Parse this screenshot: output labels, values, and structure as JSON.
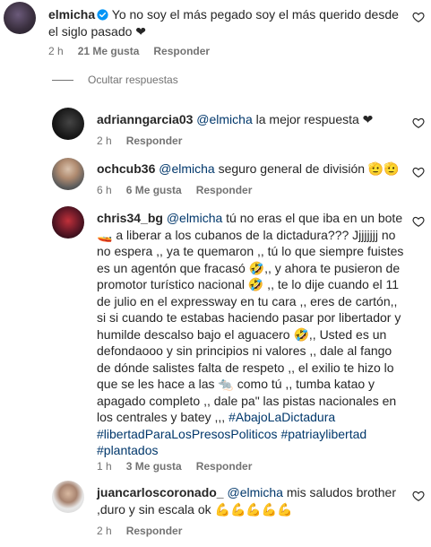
{
  "comments": [
    {
      "username": "elmicha",
      "verified": true,
      "text": "Yo no soy el más pegado soy el más querido desde el siglo pasado ❤",
      "time": "2 h",
      "likes": "21 Me gusta",
      "reply": "Responder"
    }
  ],
  "hide_replies": "Ocultar respuestas",
  "replies": [
    {
      "username": "adrianngarcia03",
      "mention": "@elmicha",
      "text": "la mejor respuesta ❤",
      "time": "2 h",
      "reply": "Responder"
    },
    {
      "username": "ochcub36",
      "mention": "@elmicha",
      "text": "seguro general de división 🫡🫡",
      "time": "6 h",
      "likes": "6 Me gusta",
      "reply": "Responder"
    },
    {
      "username": "chris34_bg",
      "mention": "@elmicha",
      "text": "tú no eras el que iba en un bote 🚤 a liberar a los cubanos de la dictadura??? Jjjjjjjj no no espera ,, ya te quemaron ,, tú lo que siempre fuistes es un agentón que fracasó 🤣,, y ahora te pusieron de promotor turístico nacional 🤣 ,, te lo dije cuando el 11 de julio en el expressway en tu cara ,, eres de cartón,, si si cuando te estabas haciendo pasar por libertador y humilde descalso bajo el aguacero 🤣,, Usted es un defondaooo y sin principios ni valores ,, dale al fango de dónde salistes falta de respeto ,, el exilio te hizo lo que se les hace a las 🐀 como tú ,, tumba katao y apagado completo ,, dale pa\" las pistas nacionales en los centrales y batey ,,,",
      "hashtags": "#AbajoLaDictadura #libertadParaLosPresosPoliticos #patriaylibertad #plantados",
      "time": "1 h",
      "likes": "3 Me gusta",
      "reply": "Responder"
    },
    {
      "username": "juancarloscoronado_",
      "mention": "@elmicha",
      "text": "mis saludos brother ,duro y sin escala ok 💪💪💪💪💪",
      "time": "2 h",
      "reply": "Responder"
    }
  ],
  "colors": {
    "text": "#262626",
    "meta": "#737373",
    "link": "#00376b",
    "verified": "#0095f6"
  }
}
